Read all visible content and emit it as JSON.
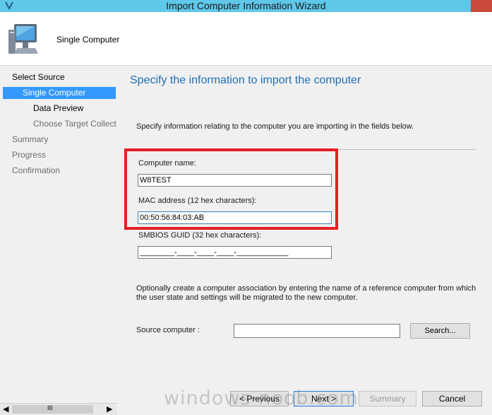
{
  "window": {
    "title": "Import Computer Information Wizard"
  },
  "header": {
    "subtitle": "Single Computer"
  },
  "sidebar": {
    "items": [
      {
        "label": "Select Source"
      },
      {
        "label": "Single Computer"
      },
      {
        "label": "Data Preview"
      },
      {
        "label": "Choose Target Collect"
      },
      {
        "label": "Summary"
      },
      {
        "label": "Progress"
      },
      {
        "label": "Confirmation"
      }
    ],
    "scroll_grip": "III"
  },
  "main": {
    "heading": "Specify the information to import the computer",
    "intro": "Specify information relating to the computer you are importing in the fields below.",
    "computer_name_label": "Computer name:",
    "computer_name_value": "W8TEST",
    "mac_label": "MAC address (12 hex characters):",
    "mac_value": "00:50:56:84:03:AB",
    "smbios_label": "SMBIOS GUID (32 hex characters):",
    "smbios_value": "________-____-____-____-____________",
    "association_line1": "Optionally create a computer association by entering the name of a reference computer from which",
    "association_line2": "the user state and settings will be migrated to the new computer.",
    "source_computer_label": "Source computer :",
    "source_computer_value": "",
    "search_button": "Search..."
  },
  "footer": {
    "previous": "< Previous",
    "next": "Next >",
    "summary": "Summary",
    "cancel": "Cancel"
  },
  "watermark": "windows-noob.com",
  "colors": {
    "titlebar": "#5fc7ea",
    "selection": "#3399ff",
    "heading": "#1f6fb5",
    "highlight": "#e41f24"
  }
}
